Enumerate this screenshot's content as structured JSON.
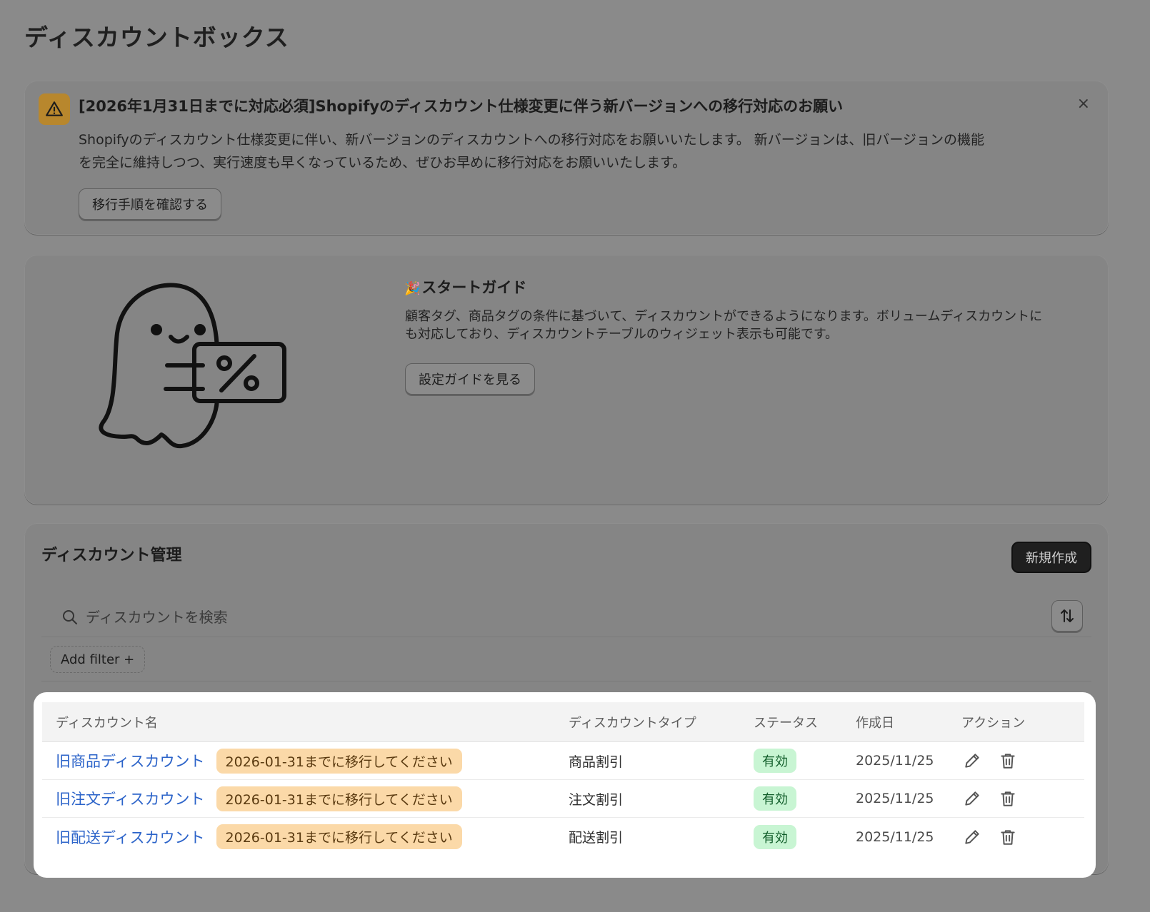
{
  "page": {
    "title": "ディスカウントボックス"
  },
  "banner": {
    "title": "[2026年1月31日までに対応必須]Shopifyのディスカウント仕様変更に伴う新バージョンへの移行対応のお願い",
    "body_line1": "Shopifyのディスカウント仕様変更に伴い、新バージョンのディスカウントへの移行対応をお願いいたします。 新バージョンは、旧バージョンの機能",
    "body_line2": "を完全に維持しつつ、実行速度も早くなっているため、ぜひお早めに移行対応をお願いいたします。",
    "button_label": "移行手順を確認する",
    "close_label": "×",
    "icon": "warning-triangle-icon"
  },
  "guide": {
    "emoji": "🎉",
    "title": "スタートガイド",
    "body_line1": "顧客タグ、商品タグの条件に基づいて、ディスカウントができるようになります。ボリュームディスカウントに",
    "body_line2": "も対応しており、ディスカウントテーブルのウィジェット表示も可能です。",
    "button_label": "設定ガイドを見る",
    "illustration": "ghost-holding-percent-ticket"
  },
  "management": {
    "title": "ディスカウント管理",
    "new_button_label": "新規作成",
    "search": {
      "placeholder": "ディスカウントを検索",
      "value": ""
    },
    "add_filter_label": "Add filter +",
    "table": {
      "columns": [
        "ディスカウント名",
        "ディスカウントタイプ",
        "ステータス",
        "作成日",
        "アクション"
      ],
      "rows": [
        {
          "name": "旧商品ディスカウント",
          "badge": "2026-01-31までに移行してください",
          "type": "商品割引",
          "status": "有効",
          "created": "2025/11/25"
        },
        {
          "name": "旧注文ディスカウント",
          "badge": "2026-01-31までに移行してください",
          "type": "注文割引",
          "status": "有効",
          "created": "2025/11/25"
        },
        {
          "name": "旧配送ディスカウント",
          "badge": "2026-01-31までに移行してください",
          "type": "配送割引",
          "status": "有効",
          "created": "2025/11/25"
        }
      ]
    }
  },
  "colors": {
    "overlay": "#8a8a8a",
    "link": "#2b63c9",
    "migrate_badge_bg": "#fbd9a8",
    "status_badge_bg": "#c8f5d3",
    "warning": "#b8872d"
  }
}
